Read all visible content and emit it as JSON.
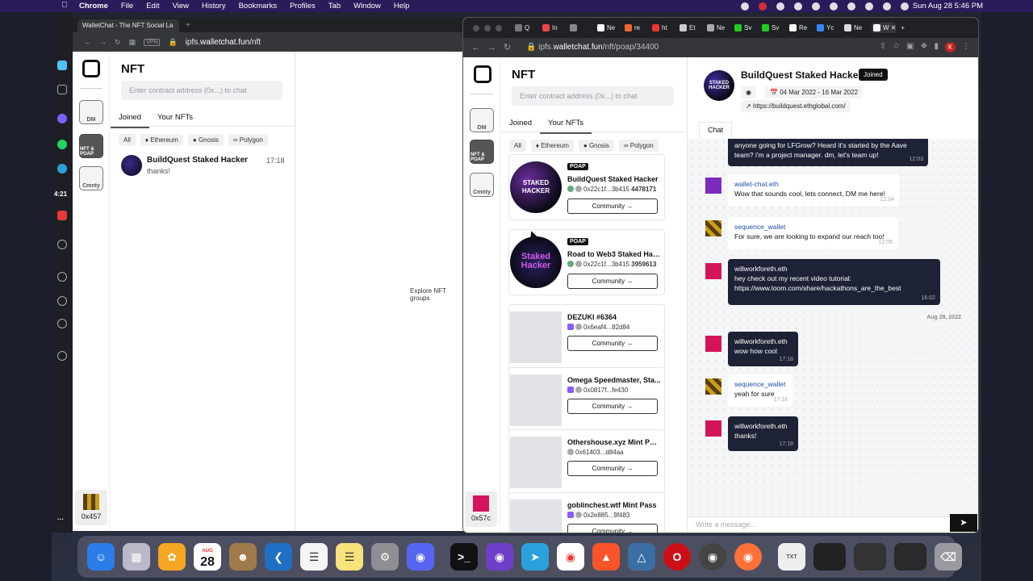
{
  "menubar": {
    "app": "Chrome",
    "items": [
      "File",
      "Edit",
      "View",
      "History",
      "Bookmarks",
      "Profiles",
      "Tab",
      "Window",
      "Help"
    ],
    "clock": "Sun Aug 28  5:46 PM"
  },
  "desktop_strip": {
    "timer": "4:21"
  },
  "window_back": {
    "tab_title": "WalletChat - The NFT Social La",
    "url_host": "walletchat.fun",
    "url_prefix": "ipfs.",
    "url_path": "/nft",
    "vpn_badge": "VPN",
    "explore_text": "Explore NFT groups",
    "user_label": "0x457"
  },
  "window_front": {
    "url_prefix": "ipfs.",
    "url_host": "walletchat.fun",
    "url_path": "/nft/poap/34400",
    "user_label": "0x57c",
    "profile_initial": "K"
  },
  "rail": {
    "dm_label": "DM",
    "nft_label": "NFT & POAP",
    "community_label": "Cmnty"
  },
  "nft_panel": {
    "title": "NFT",
    "search_placeholder": "Enter contract address (0x...) to chat",
    "tabs": [
      "Joined",
      "Your NFTs"
    ],
    "chips": [
      "All",
      "Ethereum",
      "Gnosis",
      "Polygon"
    ]
  },
  "joined_chat": {
    "name": "BuildQuest Staked Hacker",
    "last_message": "thanks!",
    "time": "17:18"
  },
  "nft_cards": [
    {
      "badge": "POAP",
      "name": "BuildQuest Staked Hacker",
      "address": "0x22c1f...3b415",
      "token": "4478171",
      "button": "Community →",
      "image_text": "STAKED HACKER"
    },
    {
      "badge": "POAP",
      "name": "Road to Web3 Staked Hac...",
      "address": "0x22c1f...3b415",
      "token": "3959613",
      "button": "Community →",
      "image_text": "Staked Hacker"
    },
    {
      "badge": "",
      "name": "DEZUKI #6364",
      "address": "0x6eaf4...82d84",
      "token": "",
      "button": "Community →"
    },
    {
      "badge": "",
      "name": "Omega Speedmaster, Sta...",
      "address": "0x0817f...fe430",
      "token": "",
      "button": "Community →"
    },
    {
      "badge": "",
      "name": "Othershouse.xyz Mint Pass",
      "address": "0x61403...d84aa",
      "token": "",
      "button": "Community →"
    },
    {
      "badge": "",
      "name": "goblinchest.wtf Mint Pass",
      "address": "0x2e885...9f483",
      "token": "",
      "button": "Community →"
    }
  ],
  "chat_header": {
    "title": "BuildQuest Staked Hacker",
    "joined_label": "Joined",
    "dates": "04 Mar 2022 - 16 Mar 2022",
    "link": "https://buildquest.ethglobal.com/",
    "tab": "Chat",
    "avatar_text": "STAKED HACKER"
  },
  "messages": [
    {
      "sender": "",
      "text": "anyone going for LFGrow? Heard it's started by the Aave team? i'm a project manager. dm, let's team up!",
      "time": "12:03",
      "style": "dark"
    },
    {
      "sender": "wallet-chat.eth",
      "text": "Wow that sounds cool, lets connect, DM me here!",
      "time": "12:04",
      "style": "light"
    },
    {
      "sender": "sequence_wallet",
      "text": "For sure, we are looking to expand our reach too!",
      "time": "12:05",
      "style": "light"
    },
    {
      "sender": "willworkforeth.eth",
      "text": "hey check out my recent video tutorial: https://www.loom.com/share/hackathons_are_the_best",
      "time": "16:02",
      "style": "dark"
    },
    {
      "sender": "willworkforeth.eth",
      "text": "wow how cool",
      "time": "17:18",
      "style": "dark"
    },
    {
      "sender": "sequence_wallet",
      "text": "yeah for sure",
      "time": "17:18",
      "style": "light"
    },
    {
      "sender": "willworkforeth.eth",
      "text": "thanks!",
      "time": "17:18",
      "style": "dark"
    }
  ],
  "date_separator": "Aug 28, 2022",
  "message_input_placeholder": "Write a message...",
  "dock": {
    "calendar_month": "AUG",
    "calendar_day": "28"
  }
}
